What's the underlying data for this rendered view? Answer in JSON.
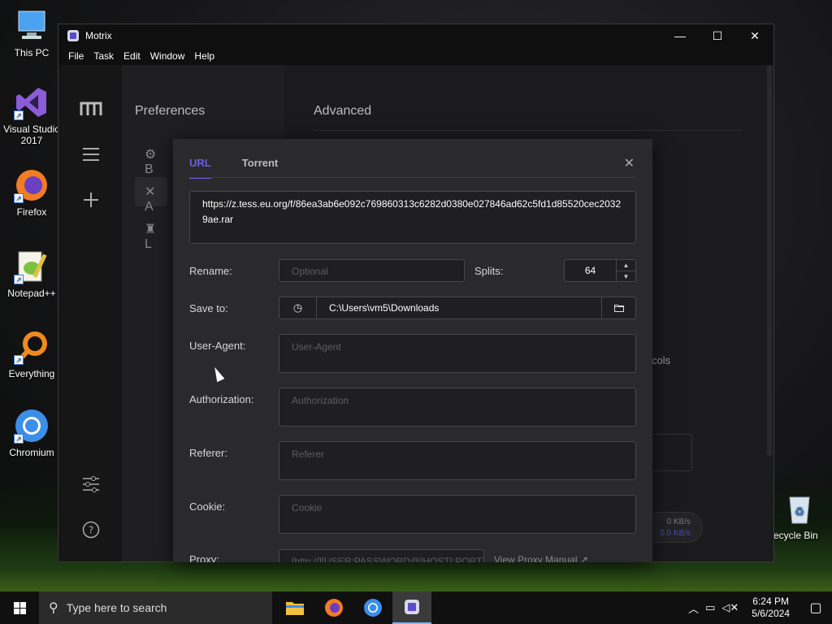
{
  "desktop": {
    "icons": [
      {
        "label": "This PC",
        "icon": "monitor-icon"
      },
      {
        "label": "Visual Studio 2017",
        "icon": "visual-studio-icon"
      },
      {
        "label": "Firefox",
        "icon": "firefox-icon"
      },
      {
        "label": "Notepad++",
        "icon": "notepad-plus-plus-icon"
      },
      {
        "label": "Everything",
        "icon": "everything-search-icon"
      },
      {
        "label": "Chromium",
        "icon": "chromium-icon"
      },
      {
        "label": "ecycle Bin",
        "icon": "recycle-bin-icon"
      }
    ]
  },
  "window": {
    "title": "Motrix",
    "controls": {
      "minimize": "—",
      "maximize": "☐",
      "close": "✕"
    },
    "menu": [
      "File",
      "Task",
      "Edit",
      "Window",
      "Help"
    ]
  },
  "preferences": {
    "heading": "Preferences",
    "items": [
      "B",
      "A",
      "L"
    ]
  },
  "content": {
    "heading": "Advanced",
    "peek_text": "cols",
    "speed_up": "0 KB/s",
    "speed_down": "0.0 KB/s"
  },
  "dialog": {
    "tabs": [
      {
        "label": "URL",
        "active": true
      },
      {
        "label": "Torrent",
        "active": false
      }
    ],
    "close": "✕",
    "url": "https://z.tess.eu.org/f/86ea3ab6e092c769860313c6282d0380e027846ad62c5fd1d85520cec20329ae.rar",
    "rename": {
      "label": "Rename:",
      "placeholder": "Optional"
    },
    "splits": {
      "label": "Splits:",
      "value": "64"
    },
    "save_to": {
      "label": "Save to:",
      "path": "C:\\Users\\vm5\\Downloads"
    },
    "user_agent": {
      "label": "User-Agent:",
      "placeholder": "User-Agent"
    },
    "authorization": {
      "label": "Authorization:",
      "placeholder": "Authorization"
    },
    "referer": {
      "label": "Referer:",
      "placeholder": "Referer"
    },
    "cookie": {
      "label": "Cookie:",
      "placeholder": "Cookie"
    },
    "proxy": {
      "label": "Proxy:",
      "placeholder": "[http://][USER:PASSWORD@]HOST[:PORT]",
      "link": "View Proxy Manual"
    }
  },
  "taskbar": {
    "search_placeholder": "Type here to search",
    "time": "6:24 PM",
    "date": "5/6/2024"
  }
}
